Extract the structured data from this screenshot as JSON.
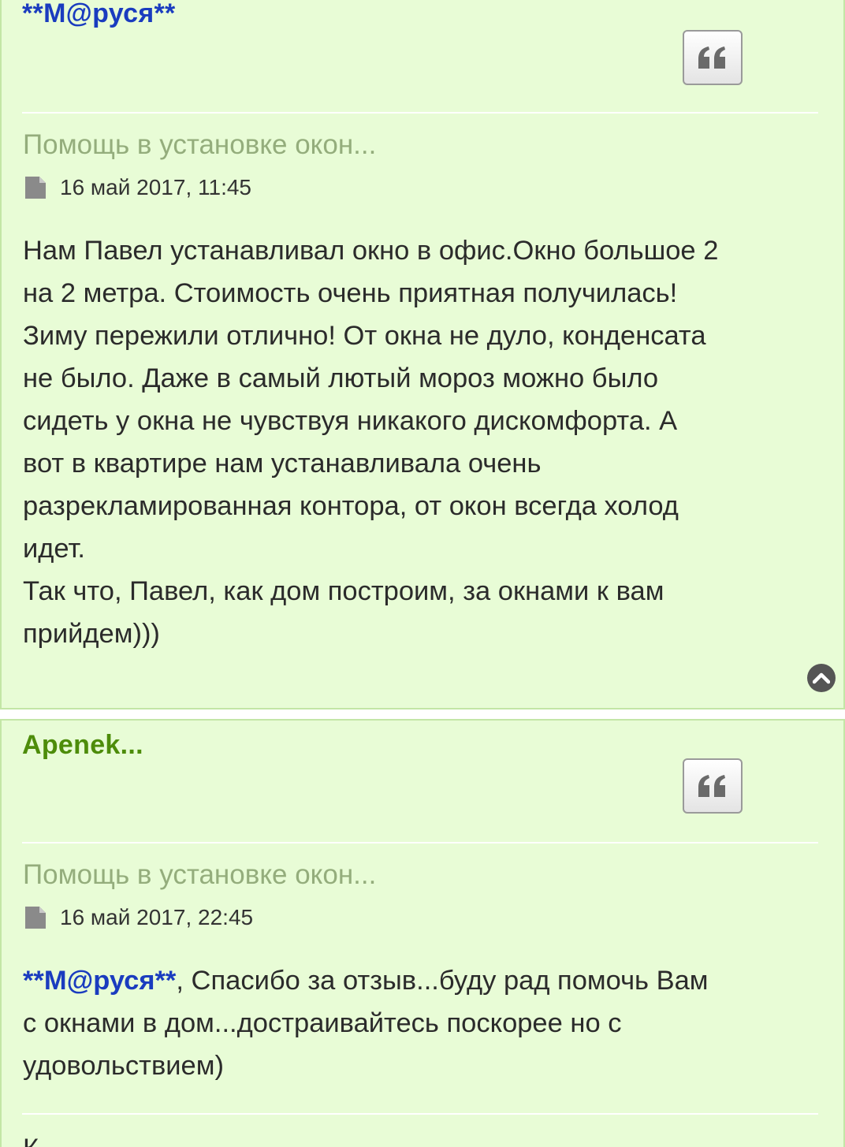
{
  "posts": [
    {
      "author": "**M@руся**",
      "author_color": "#1a3cbf",
      "quote_icon": "quote-icon",
      "topic_title": "Помощь в установке окон...",
      "file_icon": "file-icon",
      "date": "16 май 2017, 11:45",
      "content_lines": [
        "Нам Павел устанавливал окно в офис.Окно большое 2",
        "на 2 метра. Стоимость очень приятная получилась!",
        "Зиму пережили отлично! От окна не дуло, конденсата",
        "не было. Даже в самый лютый мороз можно было",
        "сидеть у окна не чувствуя никакого дискомфорта. А",
        "вот в квартире нам устанавливала очень",
        "разрекламированная контора, от окон всегда холод",
        "идет.",
        "Так что, Павел, как дом построим, за окнами к вам",
        "прийдем)))"
      ],
      "back_to_top_icon": "chevron-up-icon"
    },
    {
      "author": "Apenek...",
      "author_color": "#4d8c0a",
      "quote_icon": "quote-icon",
      "topic_title": "Помощь в установке окон...",
      "file_icon": "file-icon",
      "date": "16 май 2017, 22:45",
      "mention": "**M@руся**",
      "content_line1_rest": ", Спасибо за отзыв...буду рад помочь Вам",
      "content_lines": [
        "с окнами в дом...достраивайтесь поскорее но с",
        "удовольствием)"
      ],
      "cut_off_text": "К"
    }
  ],
  "colors": {
    "post_background": "#e8fcd6",
    "post_border": "#c3e6a6",
    "topic_title": "#94ad7c"
  }
}
